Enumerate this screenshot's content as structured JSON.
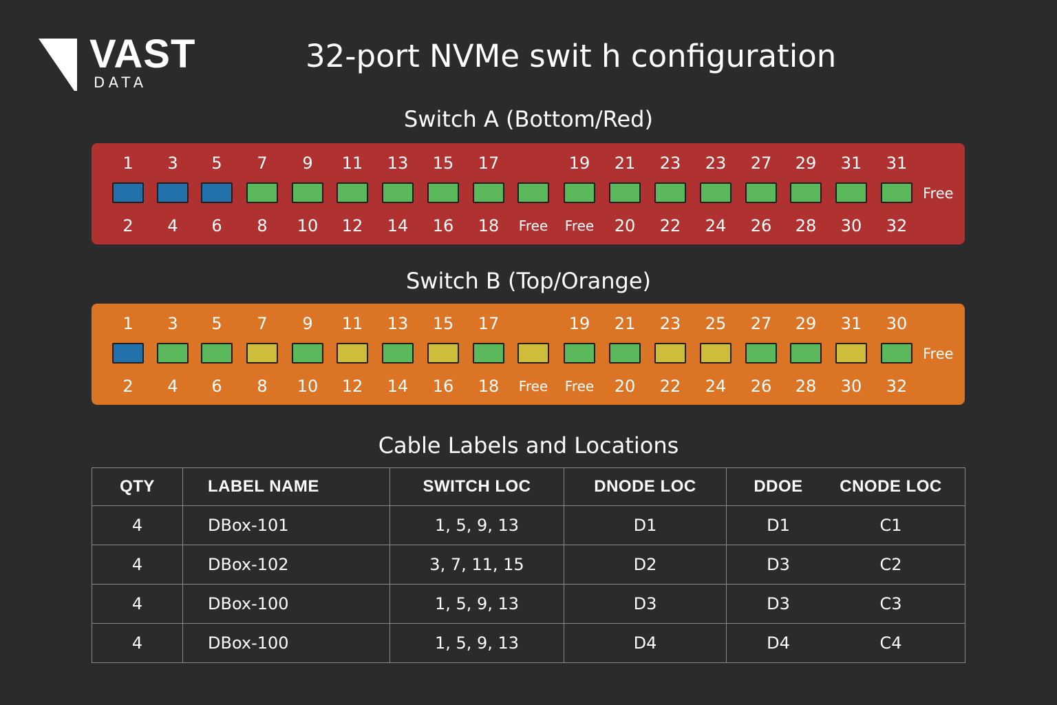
{
  "logo": {
    "word": "VAST",
    "sub": "DATA"
  },
  "page_title": "32-port NVMe swit h configuration",
  "switches": [
    {
      "title": "Switch A (Bottom/Red)",
      "top_labels": [
        "1",
        "3",
        "5",
        "7",
        "9",
        "11",
        "13",
        "15",
        "17",
        "",
        "19",
        "21",
        "23",
        "23",
        "27",
        "29",
        "31",
        "31"
      ],
      "bottom_labels": [
        "2",
        "4",
        "6",
        "8",
        "10",
        "12",
        "14",
        "16",
        "18",
        "Free",
        "Free",
        "20",
        "22",
        "24",
        "26",
        "28",
        "30",
        "32"
      ],
      "port_states": [
        "blue",
        "blue",
        "blue",
        "green",
        "green",
        "green",
        "green",
        "green",
        "green",
        "green",
        "green",
        "green",
        "green",
        "green",
        "green",
        "green",
        "green",
        "green"
      ],
      "side_label": "Free"
    },
    {
      "title": "Switch B (Top/Orange)",
      "top_labels": [
        "1",
        "3",
        "5",
        "7",
        "9",
        "11",
        "13",
        "15",
        "17",
        "",
        "19",
        "21",
        "23",
        "25",
        "27",
        "29",
        "31",
        "30"
      ],
      "bottom_labels": [
        "2",
        "4",
        "6",
        "8",
        "10",
        "12",
        "14",
        "16",
        "18",
        "Free",
        "Free",
        "20",
        "22",
        "24",
        "26",
        "28",
        "30",
        "32"
      ],
      "port_states": [
        "blue",
        "green",
        "green",
        "yellow",
        "green",
        "yellow",
        "green",
        "yellow",
        "green",
        "yellow",
        "green",
        "green",
        "yellow",
        "yellow",
        "green",
        "green",
        "yellow",
        "green"
      ],
      "side_label": "Free"
    }
  ],
  "colors": {
    "blue": "#2271ab",
    "green": "#5cb85c",
    "yellow": "#cdbd3a"
  },
  "table": {
    "title": "Cable Labels and Locations",
    "headers": [
      "QTY",
      "LABEL NAME",
      "SWITCH LOC",
      "DNODE LOC",
      "DDOE",
      "CNODE LOC"
    ],
    "rows": [
      [
        "4",
        "DBox-101",
        "1, 5, 9, 13",
        "D1",
        "D1",
        "C1"
      ],
      [
        "4",
        "DBox-102",
        "3, 7, 11, 15",
        "D2",
        "D3",
        "C2"
      ],
      [
        "4",
        "DBox-100",
        "1, 5, 9, 13",
        "D3",
        "D3",
        "C3"
      ],
      [
        "4",
        "DBox-100",
        "1, 5, 9, 13",
        "D4",
        "D4",
        "C4"
      ]
    ]
  }
}
